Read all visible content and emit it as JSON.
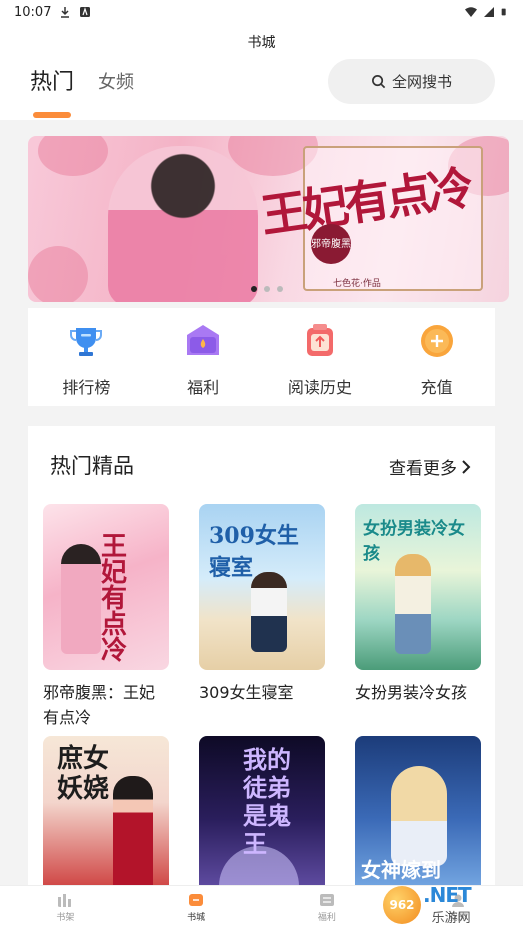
{
  "status_bar": {
    "time": "10:07"
  },
  "header": {
    "page_title": "书城",
    "tabs": [
      {
        "label": "热门"
      },
      {
        "label": "女频"
      }
    ],
    "search_label": "全网搜书"
  },
  "banner": {
    "title": "王妃有点冷",
    "seal_text": "邪帝腹黑",
    "author": "七色花·作品",
    "active_dot": 0,
    "dot_count": 3
  },
  "shortcuts": [
    {
      "label": "排行榜",
      "icon": "trophy-icon",
      "color": "#3f8ff0"
    },
    {
      "label": "福利",
      "icon": "gift-icon",
      "color": "#9b6cf0"
    },
    {
      "label": "阅读历史",
      "icon": "history-icon",
      "color": "#f05a5a"
    },
    {
      "label": "充值",
      "icon": "coin-icon",
      "color": "#f7a23a"
    }
  ],
  "hot_section": {
    "title": "热门精品",
    "more_label": "查看更多",
    "books": [
      {
        "title": "邪帝腹黑：王妃有点冷",
        "cover_text": "王妃有点冷"
      },
      {
        "title": "309女生寝室",
        "cover_text": "309女生寝室"
      },
      {
        "title": "女扮男装冷女孩",
        "cover_text": "女扮男装冷女孩"
      },
      {
        "title": "",
        "cover_text": "庶女妖娆"
      },
      {
        "title": "",
        "cover_text": "我的徒弟是鬼王"
      },
      {
        "title": "",
        "cover_text": "女神嫁到"
      }
    ]
  },
  "bottom_nav": [
    {
      "label": "书架",
      "icon": "bookshelf-icon"
    },
    {
      "label": "书城",
      "icon": "bookstore-icon"
    },
    {
      "label": "福利",
      "icon": "welfare-icon"
    },
    {
      "label": "我的",
      "icon": "profile-icon"
    }
  ],
  "watermark": {
    "badge": "962",
    "net": ".NET",
    "sub": "乐游网"
  },
  "colors": {
    "accent": "#fb8c3a",
    "search_bg": "#f0f0f0",
    "page_bg": "#f3f3f3"
  }
}
